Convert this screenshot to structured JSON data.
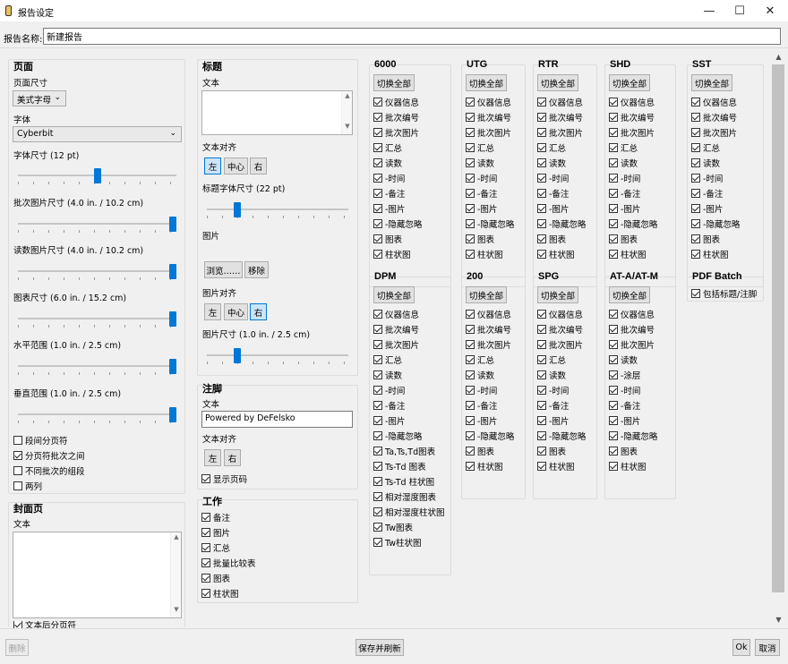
{
  "window": {
    "title": "报告设定",
    "minimize": "—",
    "maximize": "☐",
    "close": "✕"
  },
  "report_name": {
    "label": "报告名称:",
    "value": "新建报告"
  },
  "page": {
    "title": "页面",
    "page_size_label": "页面尺寸",
    "page_size": "美式字母",
    "font_label": "字体",
    "font": "Cyberbit",
    "font_size_label": "字体尺寸 (12 pt)",
    "font_size_level": 0.5,
    "batch_img_label": "批次图片尺寸 (4.0 in. / 10.2 cm)",
    "batch_img_level": 1.0,
    "read_img_label": "读数图片尺寸 (4.0 in. / 10.2 cm)",
    "read_img_level": 1.0,
    "chart_label": "图表尺寸 (6.0 in. / 15.2 cm)",
    "chart_level": 1.0,
    "hrange_label": "水平范围 (1.0 in. / 2.5 cm)",
    "hrange_level": 1.0,
    "vrange_label": "垂直范围 (1.0 in. / 2.5 cm)",
    "vrange_level": 1.0,
    "checks": [
      {
        "label": "段间分页符",
        "checked": false
      },
      {
        "label": "分页符批次之间",
        "checked": true
      },
      {
        "label": "不同批次的组段",
        "checked": false
      },
      {
        "label": "两列",
        "checked": false
      }
    ]
  },
  "cover": {
    "title": "封面页",
    "text_label": "文本",
    "text_value": "",
    "after_check": "文本后分页符"
  },
  "header": {
    "title": "标题",
    "text_label": "文本",
    "text_value": "",
    "align_label": "文本对齐",
    "align_left": "左",
    "align_center": "中心",
    "align_right": "右",
    "font_size_label": "标题字体尺寸 (22 pt)",
    "font_size_level": 0.2,
    "image_label": "图片",
    "browse": "浏览……",
    "remove": "移除",
    "img_align_label": "图片对齐",
    "img_size_label": "图片尺寸 (1.0 in. / 2.5 cm)",
    "img_size_level": 0.2
  },
  "footer": {
    "title": "注脚",
    "text_label": "文本",
    "text_value": "Powered by DeFelsko",
    "align_label": "文本对齐",
    "align_left": "左",
    "align_right": "右",
    "show_page": "显示页码"
  },
  "work": {
    "title": "工作",
    "items": [
      "备注",
      "图片",
      "汇总",
      "批量比较表",
      "图表",
      "柱状图"
    ]
  },
  "toggle_all": "切换全部",
  "devices_row1": [
    {
      "name": "6000",
      "items": [
        "仪器信息",
        "批次编号",
        "批次图片",
        "汇总",
        "读数",
        "-时间",
        "-备注",
        "-图片",
        "-隐藏忽略",
        "图表",
        "柱状图"
      ]
    },
    {
      "name": "UTG",
      "items": [
        "仪器信息",
        "批次编号",
        "批次图片",
        "汇总",
        "读数",
        "-时间",
        "-备注",
        "-图片",
        "-隐藏忽略",
        "图表",
        "柱状图"
      ]
    },
    {
      "name": "RTR",
      "items": [
        "仪器信息",
        "批次编号",
        "批次图片",
        "汇总",
        "读数",
        "-时间",
        "-备注",
        "-图片",
        "-隐藏忽略",
        "图表",
        "柱状图"
      ]
    },
    {
      "name": "SHD",
      "items": [
        "仪器信息",
        "批次编号",
        "批次图片",
        "汇总",
        "读数",
        "-时间",
        "-备注",
        "-图片",
        "-隐藏忽略",
        "图表",
        "柱状图"
      ]
    },
    {
      "name": "SST",
      "items": [
        "仪器信息",
        "批次编号",
        "批次图片",
        "汇总",
        "读数",
        "-时间",
        "-备注",
        "-图片",
        "-隐藏忽略",
        "图表",
        "柱状图"
      ]
    }
  ],
  "devices_row2": [
    {
      "name": "DPM",
      "items": [
        "仪器信息",
        "批次编号",
        "批次图片",
        "汇总",
        "读数",
        "-时间",
        "-备注",
        "-图片",
        "-隐藏忽略",
        "Ta,Ts,Td图表",
        "Ts-Td 图表",
        "Ts-Td 柱状图",
        "相对湿度图表",
        "相对湿度柱状图",
        "Tw图表",
        "Tw柱状图"
      ]
    },
    {
      "name": "200",
      "items": [
        "仪器信息",
        "批次编号",
        "批次图片",
        "汇总",
        "读数",
        "-时间",
        "-备注",
        "-图片",
        "-隐藏忽略",
        "图表",
        "柱状图"
      ]
    },
    {
      "name": "SPG",
      "items": [
        "仪器信息",
        "批次编号",
        "批次图片",
        "汇总",
        "读数",
        "-时间",
        "-备注",
        "-图片",
        "-隐藏忽略",
        "图表",
        "柱状图"
      ]
    },
    {
      "name": "AT-A/AT-M",
      "items": [
        "仪器信息",
        "批次编号",
        "批次图片",
        "读数",
        "-涂层",
        "-时间",
        "-备注",
        "-图片",
        "-隐藏忽略",
        "图表",
        "柱状图"
      ]
    }
  ],
  "pdf_batch": {
    "name": "PDF Batch",
    "item": "包括标题/注脚"
  },
  "buttons": {
    "delete": "删除",
    "save_refresh": "保存并刷新",
    "ok": "Ok",
    "cancel": "取消"
  }
}
